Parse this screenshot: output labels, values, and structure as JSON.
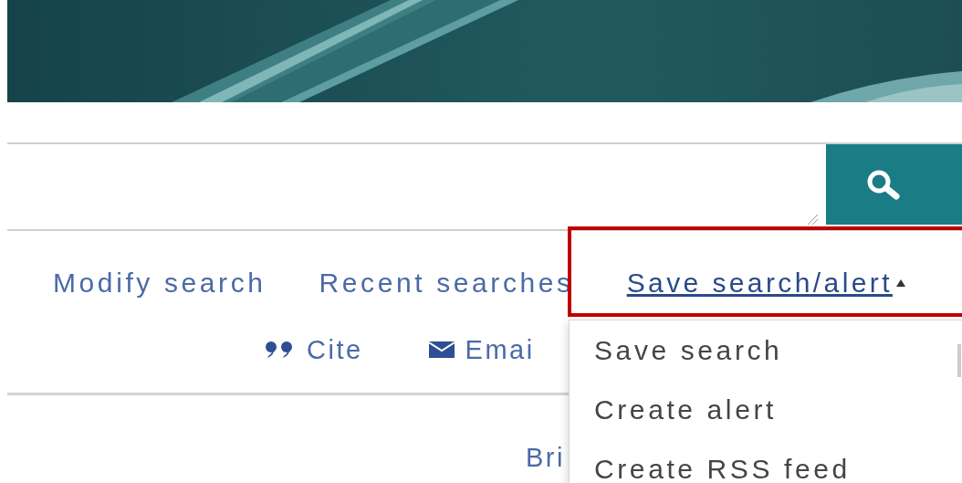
{
  "links": [
    {
      "label": "Modify search"
    },
    {
      "label": "Recent searches"
    }
  ],
  "save_menu": {
    "label": "Save search/alert",
    "expanded": true,
    "items": [
      {
        "label": "Save search"
      },
      {
        "label": "Create alert"
      },
      {
        "label": "Create RSS feed"
      }
    ]
  },
  "actions": [
    {
      "kind": "cite",
      "label": "Cite"
    },
    {
      "kind": "email",
      "label": "Emai"
    }
  ],
  "below": {
    "label": "Bri"
  },
  "highlight": {
    "shown": true
  }
}
